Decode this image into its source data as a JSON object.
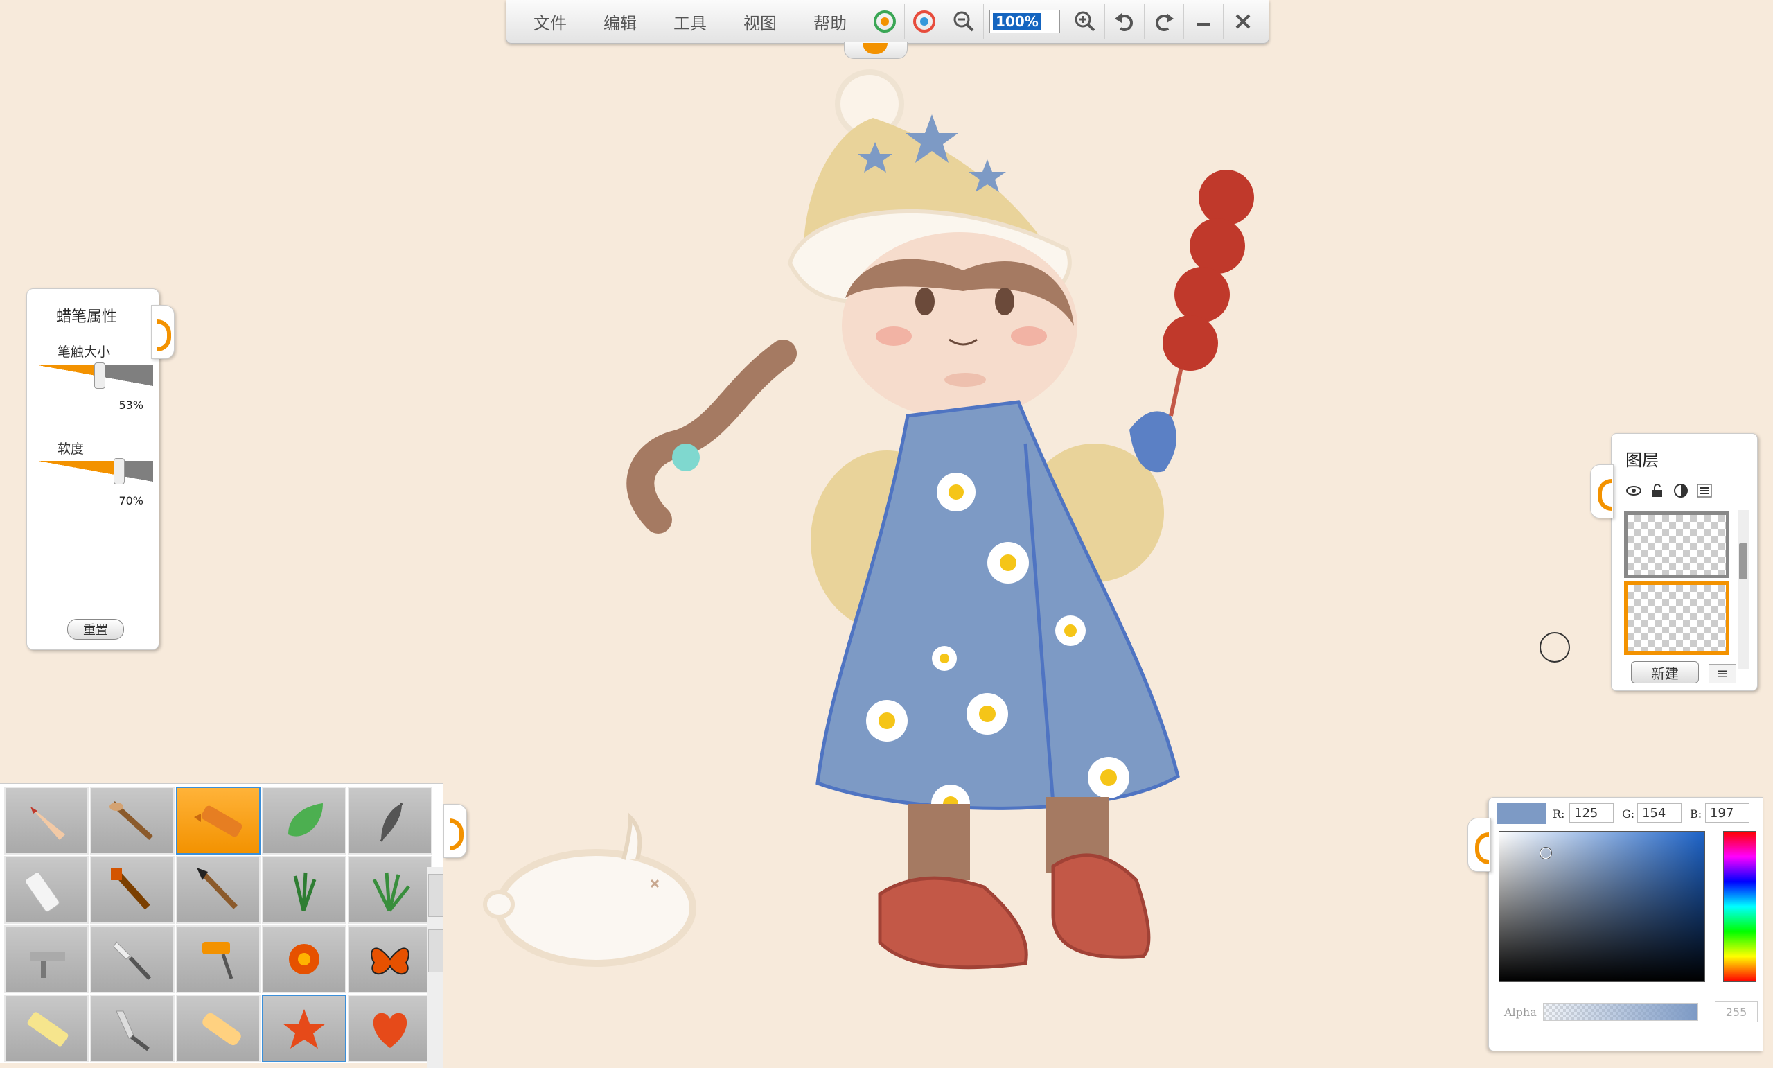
{
  "menu": {
    "file": "文件",
    "edit": "编辑",
    "tools": "工具",
    "view": "视图",
    "help": "帮助"
  },
  "toolbar": {
    "zoom_value": "100%",
    "icons": [
      "color-theme-icon-1",
      "color-theme-icon-2",
      "zoom-out-icon",
      "zoom-in-icon",
      "undo-icon",
      "redo-icon",
      "minimize-icon",
      "close-icon"
    ]
  },
  "brush_panel": {
    "title": "蜡笔属性",
    "size_label": "笔触大小",
    "size_value": 0.53,
    "size_text": "53%",
    "softness_label": "软度",
    "softness_value": 0.7,
    "softness_text": "70%",
    "reset_label": "重置"
  },
  "tools": [
    "pencil",
    "brush",
    "crayon",
    "leaf-stamp",
    "feather",
    "eraser",
    "flat-brush",
    "ink-brush",
    "grass-stamp",
    "grass-clump",
    "airbrush",
    "palette-knife",
    "roller",
    "flower-stamp",
    "butterfly-stamp",
    "chalk",
    "knife",
    "marker",
    "star-stamp",
    "heart-stamp"
  ],
  "selected_tool": "crayon",
  "layers_panel": {
    "title": "图层",
    "new_label": "新建",
    "icons": [
      "eye-icon",
      "lock-icon",
      "contrast-icon",
      "menu-icon"
    ]
  },
  "color": {
    "swatch": "#7d9ac5",
    "r_label": "R:",
    "g_label": "G:",
    "b_label": "B:",
    "r": "125",
    "g": "154",
    "b": "197",
    "alpha_label": "Alpha",
    "alpha_value": "255"
  },
  "colors": {
    "accent": "#f39200",
    "canvas": "#f7eadb"
  }
}
